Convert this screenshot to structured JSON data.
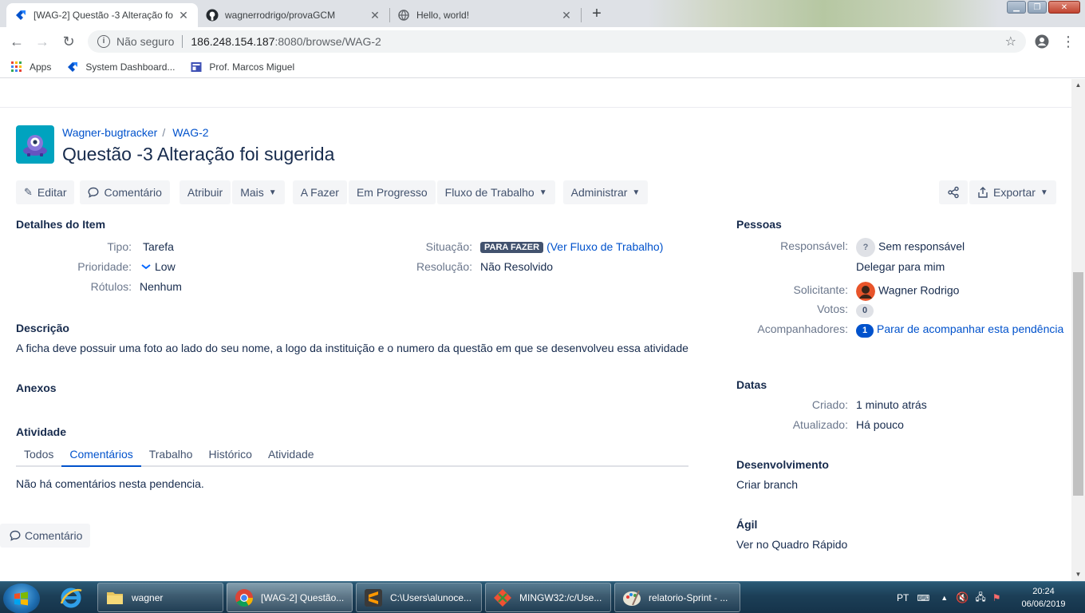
{
  "browser": {
    "tabs": [
      {
        "title": "[WAG-2] Questão -3 Alteração fo",
        "active": true
      },
      {
        "title": "wagnerrodrigo/provaGCM",
        "active": false
      },
      {
        "title": "Hello, world!",
        "active": false
      }
    ],
    "address": {
      "security": "Não seguro",
      "host": "186.248.154.187",
      "path": ":8080/browse/WAG-2"
    },
    "bookmarks": [
      {
        "label": "Apps"
      },
      {
        "label": "System Dashboard..."
      },
      {
        "label": "Prof. Marcos Miguel"
      }
    ]
  },
  "issue": {
    "project": "Wagner-bugtracker",
    "key": "WAG-2",
    "title": "Questão -3 Alteração foi sugerida"
  },
  "toolbar": {
    "edit": "Editar",
    "comment": "Comentário",
    "assign": "Atribuir",
    "more": "Mais",
    "todo": "A Fazer",
    "in_progress": "Em Progresso",
    "workflow": "Fluxo de Trabalho",
    "admin": "Administrar",
    "export": "Exportar"
  },
  "details": {
    "title": "Detalhes do Item",
    "type_label": "Tipo:",
    "type_value": "Tarefa",
    "priority_label": "Prioridade:",
    "priority_value": "Low",
    "labels_label": "Rótulos:",
    "labels_value": "Nenhum",
    "status_label": "Situação:",
    "status_value": "PARA FAZER",
    "status_link": "(Ver Fluxo de Trabalho)",
    "resolution_label": "Resolução:",
    "resolution_value": "Não Resolvido"
  },
  "description": {
    "title": "Descrição",
    "text": "A ficha deve possuir uma foto ao lado do seu nome, a logo da instituição e o numero da questão em que se desenvolveu essa atividade"
  },
  "attachments": {
    "title": "Anexos"
  },
  "activity": {
    "title": "Atividade",
    "tabs": [
      "Todos",
      "Comentários",
      "Trabalho",
      "Histórico",
      "Atividade"
    ],
    "selected": 1,
    "empty": "Não há comentários nesta pendencia.",
    "comment_button": "Comentário"
  },
  "people": {
    "title": "Pessoas",
    "assignee_label": "Responsável:",
    "assignee_value": "Sem responsável",
    "assign_me": "Delegar para mim",
    "reporter_label": "Solicitante:",
    "reporter_value": "Wagner Rodrigo",
    "votes_label": "Votos:",
    "votes_value": "0",
    "watchers_label": "Acompanhadores:",
    "watchers_value": "1",
    "watchers_link": "Parar de acompanhar esta pendência"
  },
  "dates": {
    "title": "Datas",
    "created_label": "Criado:",
    "created_value": "1 minuto atrás",
    "updated_label": "Atualizado:",
    "updated_value": "Há pouco"
  },
  "development": {
    "title": "Desenvolvimento",
    "link": "Criar branch"
  },
  "agile": {
    "title": "Ágil",
    "link": "Ver no Quadro Rápido"
  },
  "taskbar": {
    "items": [
      {
        "label": "wagner"
      },
      {
        "label": "[WAG-2] Questão..."
      },
      {
        "label": "C:\\Users\\alunoce..."
      },
      {
        "label": "MINGW32:/c/Use..."
      },
      {
        "label": "relatorio-Sprint - ..."
      }
    ],
    "lang": "PT",
    "time": "20:24",
    "date": "06/06/2019"
  },
  "colors": {
    "link": "#0052cc",
    "text": "#172b4d",
    "muted": "#6b778c",
    "lozenge": "#42526e",
    "project_icon": "#00a3bf"
  }
}
